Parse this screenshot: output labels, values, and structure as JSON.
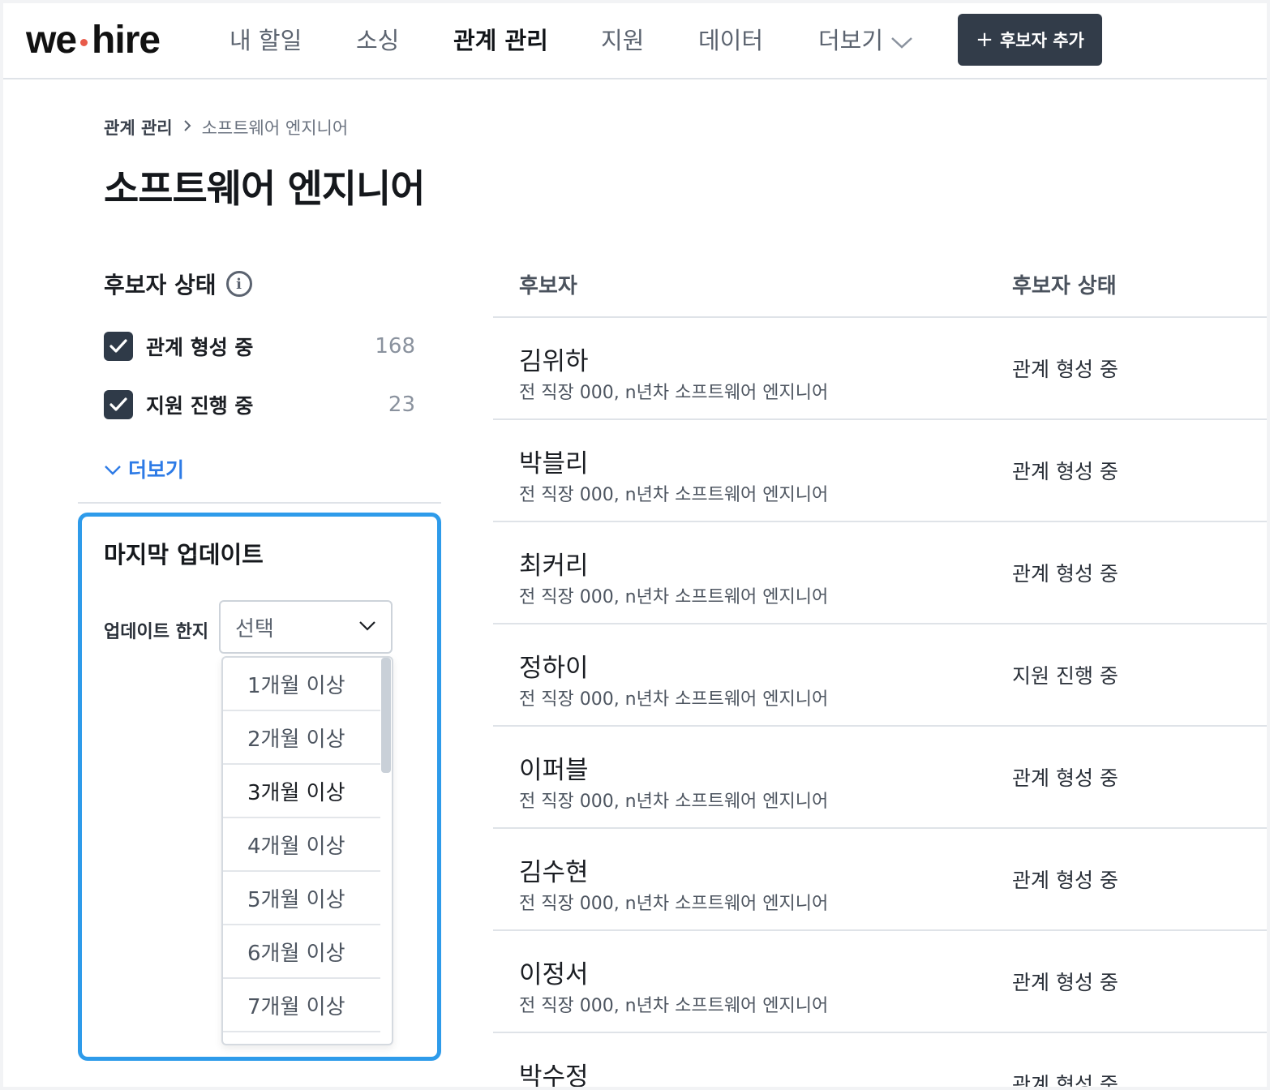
{
  "app": {
    "logo_left": "we",
    "logo_right": "hire"
  },
  "nav": {
    "items": [
      {
        "label": "내 할일"
      },
      {
        "label": "소싱"
      },
      {
        "label": "관계 관리"
      },
      {
        "label": "지원"
      },
      {
        "label": "데이터"
      },
      {
        "label": "더보기"
      }
    ],
    "active": "관계 관리",
    "add_candidate_label": "후보자 추가",
    "add_icon": "+"
  },
  "breadcrumb": {
    "root": "관계 관리",
    "current": "소프트웨어 엔지니어"
  },
  "page": {
    "title": "소프트웨어 엔지니어"
  },
  "filters": {
    "heading": "후보자 상태",
    "info_icon": "i",
    "options": [
      {
        "label": "관계 형성 중",
        "count": "168",
        "checked": true
      },
      {
        "label": "지원 진행 중",
        "count": "23",
        "checked": true
      }
    ],
    "more_label": "더보기"
  },
  "last_update": {
    "title": "마지막 업데이트",
    "field_label": "업데이트 한지",
    "select_placeholder": "선택",
    "options": [
      "1개월 이상",
      "2개월 이상",
      "3개월 이상",
      "4개월 이상",
      "5개월 이상",
      "6개월 이상",
      "7개월 이상"
    ],
    "hovered_option": "3개월 이상"
  },
  "table": {
    "columns": [
      "후보자",
      "후보자 상태"
    ],
    "rows": [
      {
        "name": "김위하",
        "detail": "전 직장 000, n년차 소프트웨어 엔지니어",
        "status": "관계 형성 중"
      },
      {
        "name": "박블리",
        "detail": "전 직장 000, n년차 소프트웨어 엔지니어",
        "status": "관계 형성 중"
      },
      {
        "name": "최커리",
        "detail": "전 직장 000, n년차 소프트웨어 엔지니어",
        "status": "관계 형성 중"
      },
      {
        "name": "정하이",
        "detail": "전 직장 000, n년차 소프트웨어 엔지니어",
        "status": "지원 진행 중"
      },
      {
        "name": "이퍼블",
        "detail": "전 직장 000, n년차 소프트웨어 엔지니어",
        "status": "관계 형성 중"
      },
      {
        "name": "김수현",
        "detail": "전 직장 000, n년차 소프트웨어 엔지니어",
        "status": "관계 형성 중"
      },
      {
        "name": "이정서",
        "detail": "전 직장 000, n년차 소프트웨어 엔지니어",
        "status": "관계 형성 중"
      },
      {
        "name": "박수정",
        "detail": "",
        "status": "관계 형성 중"
      }
    ]
  },
  "colors": {
    "accent_blue": "#2e7be6",
    "highlight_border": "#2e9bea",
    "primary_button": "#323c49",
    "logo_dot": "#e85b4a"
  }
}
